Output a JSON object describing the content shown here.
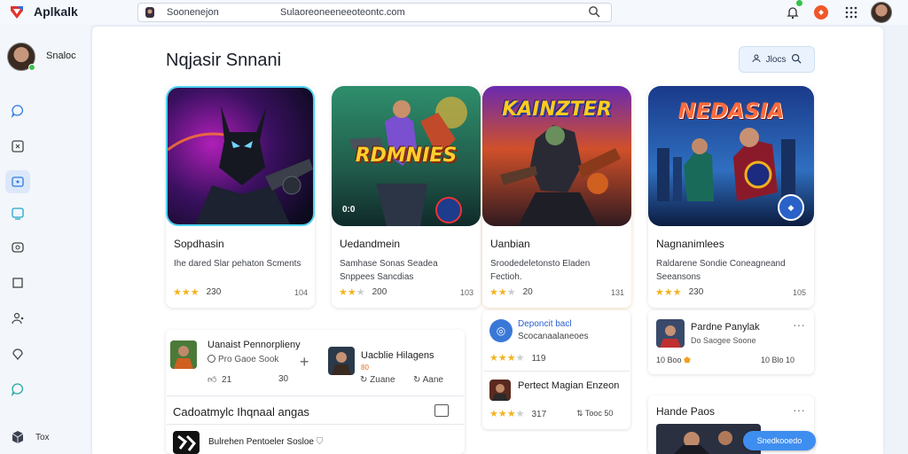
{
  "app": {
    "name": "Aplkalk"
  },
  "urlbar": {
    "left_text": "Soonenejon",
    "right_text": "Sulaoreoneeneeoteontc.com"
  },
  "sidebar": {
    "profile_name": "Snaloc",
    "bottom_label": "Tox"
  },
  "page": {
    "title": "Nqjasir Snnani",
    "filter_label": "Jlocs"
  },
  "cards": [
    {
      "art_title": "",
      "title": "Sopdhasin",
      "desc": "Ihe dared Slar pehaton Scments",
      "stars": 3,
      "rating": "230",
      "right": "104"
    },
    {
      "art_title": "RDMNIES",
      "badge": "0:0",
      "title": "Uedandmein",
      "desc": "Samhase Sonas Seadea Snppees Sancdias",
      "stars": 3,
      "rating": "200",
      "right": "103"
    },
    {
      "art_title": "KAINZTER",
      "title": "Uanbian",
      "desc": "Sroodedeletonsto Eladen Fectioh.",
      "stars": 3,
      "rating": "20",
      "right": "131"
    },
    {
      "art_title": "NEDASIA",
      "title": "Nagnanimlees",
      "desc": "Raldarene Sondie Coneagneand Seeansons",
      "stars": 3,
      "rating": "230",
      "right": "105"
    }
  ],
  "feed": {
    "post1": {
      "name": "Uanaist Pennorplieny",
      "sub": "Pro Gaoe Sook",
      "likes": "21",
      "comments": "30"
    },
    "post2": {
      "name": "Uacblie Hilagens",
      "sub": "80",
      "action1": "Zuane",
      "action2": "Aane"
    },
    "section_title": "Cadoatmylc Ihqnaal angas",
    "row_title": "Bulrehen Pentoeler Sosloe"
  },
  "sidepanel3": {
    "item1": {
      "title": "Deponcit bacl",
      "sub": "Scocanaalaneoes",
      "rating": "119"
    },
    "item2": {
      "title": "Pertect Magian Enzeon",
      "rating": "317",
      "extra": "Tooc 50"
    }
  },
  "sidepanel4": {
    "item1": {
      "title": "Pardne Panylak",
      "sub": "Do Saogee Soone",
      "meta1": "10 Boo",
      "meta2": "10 Blo 10"
    },
    "section_title": "Hande Paos"
  },
  "chat_label": "Snedkooedo"
}
